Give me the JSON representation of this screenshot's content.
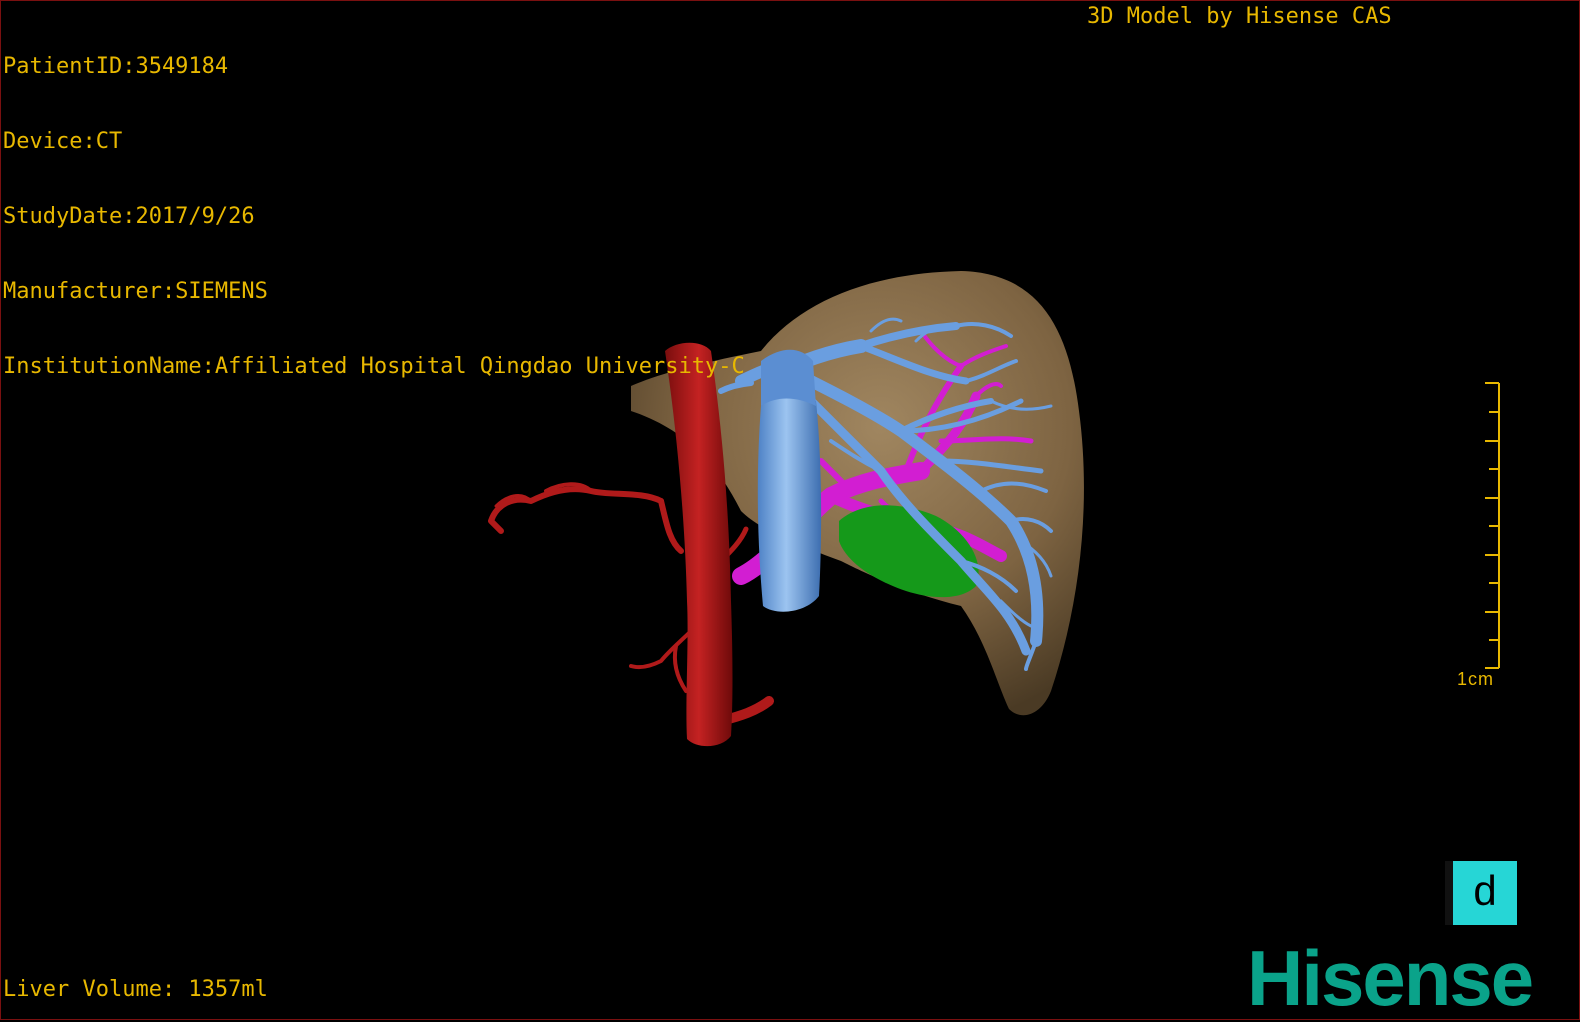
{
  "overlay": {
    "patient_id": "PatientID:3549184",
    "device": "Device:CT",
    "study_date": "StudyDate:2017/9/26",
    "manufacturer": "Manufacturer:SIEMENS",
    "institution": "InstitutionName:Affiliated Hospital Qingdao University-C",
    "model_label": "3D Model by Hisense CAS",
    "liver_volume": "Liver Volume: 1357ml"
  },
  "scale_bar": {
    "label": "1cm"
  },
  "view_mode_button": {
    "label": "d"
  },
  "brand": {
    "logo_text": "Hisense"
  },
  "colors": {
    "overlay_text": "#e8b800",
    "liver": "#8a6e4a",
    "artery": "#b01a1a",
    "vein": "#6a9ee0",
    "portal_vein": "#d21ed2",
    "gallbladder": "#1aa01a",
    "mode_button": "#26d6d6",
    "brand": "#0aa38a"
  }
}
